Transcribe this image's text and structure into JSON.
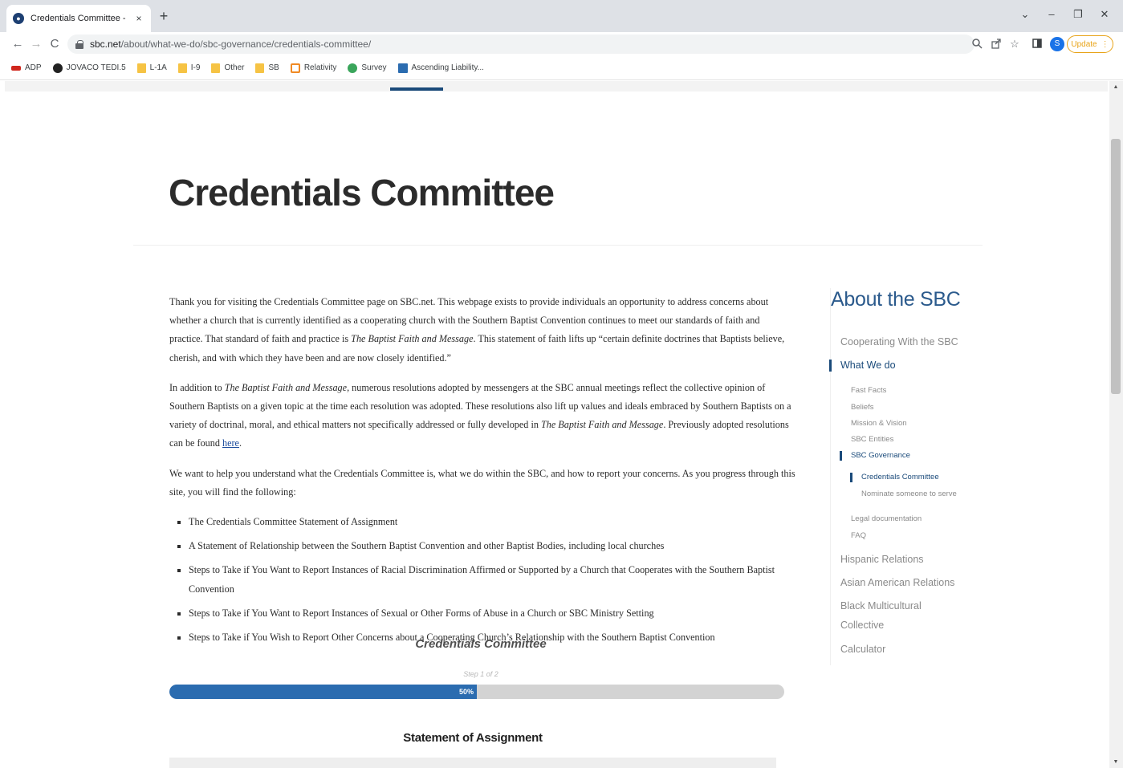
{
  "browser": {
    "tab_title": "Credentials Committee - SBC.net",
    "tab_close": "×",
    "new_tab": "+",
    "url_host": "sbc.net",
    "url_path": "/about/what-we-do/sbc-governance/credentials-committee/",
    "profile_initial": "S",
    "update_label": "Update",
    "window_controls": [
      "⌄",
      "–",
      "❐",
      "✕"
    ],
    "nav_icons": [
      "←",
      "→",
      "C"
    ],
    "toolbar_icons": [
      "zoom-icon",
      "share-icon",
      "star-icon",
      "sidepanel-icon"
    ]
  },
  "bookmarks": [
    {
      "label": "ADP",
      "icon": "adp-icon",
      "color": "#d0271d"
    },
    {
      "label": "JOVACO TEDI.5",
      "icon": "jovaco-icon",
      "color": "#222222"
    },
    {
      "label": "L-1A",
      "icon": "folder-icon",
      "color": "#f6c344"
    },
    {
      "label": "I-9",
      "icon": "folder-icon",
      "color": "#f6c344"
    },
    {
      "label": "Other",
      "icon": "folder-icon",
      "color": "#f6c344"
    },
    {
      "label": "SB",
      "icon": "folder-icon",
      "color": "#f6c344"
    },
    {
      "label": "Relativity",
      "icon": "relativity-icon",
      "color": "#f08a24"
    },
    {
      "label": "Survey",
      "icon": "survey-icon",
      "color": "#3aa55b"
    },
    {
      "label": "Ascending Liability...",
      "icon": "ascending-icon",
      "color": "#2b6cb0"
    }
  ],
  "page": {
    "title": "Credentials Committee",
    "paragraphs": {
      "p1_a": "Thank you for visiting the Credentials Committee page on SBC.net. This webpage exists to provide individuals an opportunity to address concerns about whether a church that is currently identified as a cooperating church with the Southern Baptist Convention continues to meet our standards of faith and practice. That standard of faith and practice is ",
      "p1_em": "The Baptist Faith and Message",
      "p1_b": ". This statement of faith lifts up “certain definite doctrines that Baptists believe, cherish, and with which they have been and are now closely identified.”",
      "p2_a": "In addition to ",
      "p2_em1": "The Baptist Faith and Message",
      "p2_b": ", numerous resolutions adopted by messengers at the SBC annual meetings reflect the collective opinion of Southern Baptists on a given topic at the time each resolution was adopted. These resolutions also lift up values and ideals embraced by Southern Baptists on a variety of doctrinal, moral, and ethical matters not specifically addressed or fully developed in ",
      "p2_em2": "The Baptist Faith and Message",
      "p2_c": ". Previously adopted resolutions can be found ",
      "p2_link": "here",
      "p2_d": ".",
      "p3": "We want to help you understand what the Credentials Committee is, what we do within the SBC, and how to report your concerns. As you progress through this site, you will find the following:"
    },
    "bullets": [
      "The Credentials Committee Statement of Assignment",
      "A Statement of Relationship between the Southern Baptist Convention and other Baptist Bodies, including local churches",
      "Steps to Take if You Want to Report Instances of Racial Discrimination Affirmed or Supported by a Church that Cooperates with the Southern Baptist Convention",
      "Steps to Take if You Want to Report Instances of Sexual or Other Forms of Abuse in a Church or SBC Ministry Setting",
      "Steps to Take if You Wish to Report Other Concerns about a Cooperating Church’s Relationship with the Southern Baptist Convention"
    ],
    "form": {
      "heading": "Credentials Committee",
      "step": "Step 1 of 2",
      "progress_value": 0.5,
      "progress_label": "50%",
      "section_heading": "Statement of Assignment"
    }
  },
  "sidebar": {
    "title": "About the SBC",
    "items": {
      "cooperating": "Cooperating With the SBC",
      "what_we_do": "What We do",
      "fast_facts": "Fast Facts",
      "beliefs": "Beliefs",
      "mission": "Mission & Vision",
      "entities": "SBC Entities",
      "governance": "SBC Governance",
      "credentials": "Credentials Committee",
      "nominate": "Nominate someone to serve",
      "legal": "Legal documentation",
      "faq": "FAQ",
      "hispanic": "Hispanic Relations",
      "asian": "Asian American Relations",
      "black_1": "Black Multicultural",
      "black_2": "Collective",
      "calculator": "Calculator"
    }
  },
  "colors": {
    "accent": "#1a4a7a",
    "link": "#2b5a8c",
    "progress": "#2b6cb0",
    "update": "#e8a317"
  }
}
